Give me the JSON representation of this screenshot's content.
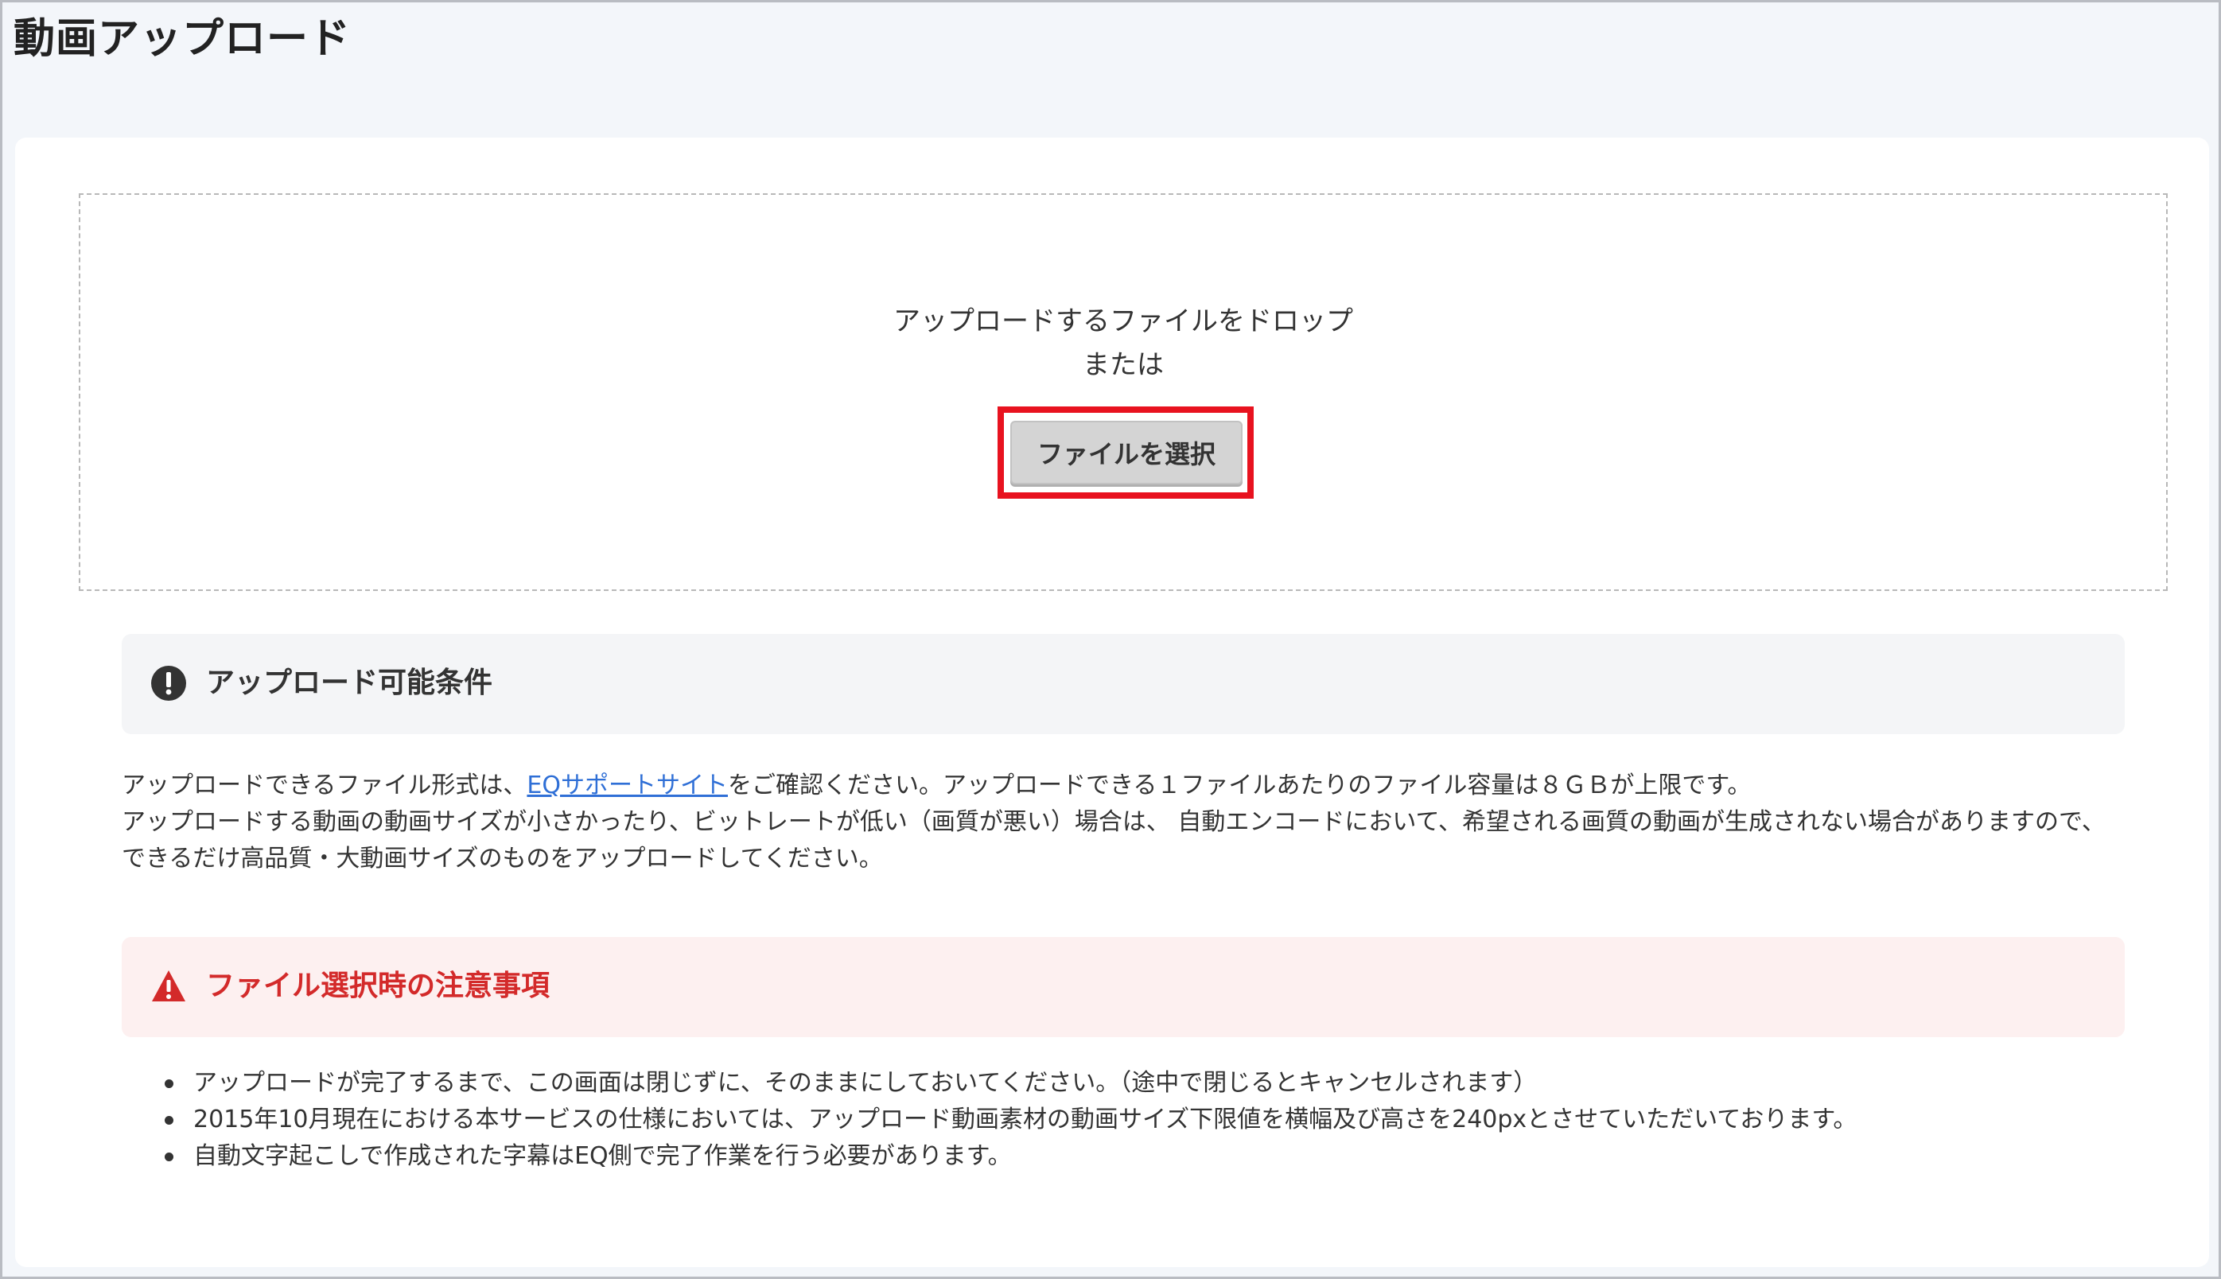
{
  "page": {
    "title": "動画アップロード"
  },
  "dropzone": {
    "line1": "アップロードするファイルをドロップ",
    "line2": "または",
    "button_label": "ファイルを選択"
  },
  "conditions": {
    "title": "アップロード可能条件",
    "icon": "exclamation-circle-icon",
    "p1_before": "アップロードできるファイル形式は、",
    "p1_link": "EQサポートサイト",
    "p1_after": "をご確認ください。アップロードできる１ファイルあたりのファイル容量は８ＧＢが上限です。",
    "p2": "アップロードする動画の動画サイズが小さかったり、ビットレートが低い（画質が悪い）場合は、 自動エンコードにおいて、希望される画質の動画が生成されない場合がありますので、 できるだけ高品質・大動画サイズのものをアップロードしてください。"
  },
  "warning": {
    "title": "ファイル選択時の注意事項",
    "icon": "warning-triangle-icon",
    "items": [
      "アップロードが完了するまで、この画面は閉じずに、そのままにしておいてください。（途中で閉じるとキャンセルされます）",
      "2015年10月現在における本サービスの仕様においては、アップロード動画素材の動画サイズ下限値を横幅及び高さを240pxとさせていただいております。",
      "自動文字起こしで作成された字幕はEQ側で完了作業を行う必要があります。"
    ]
  },
  "colors": {
    "highlight": "#e8121f",
    "warning_text": "#d32a2a",
    "link": "#2f6fd6"
  }
}
